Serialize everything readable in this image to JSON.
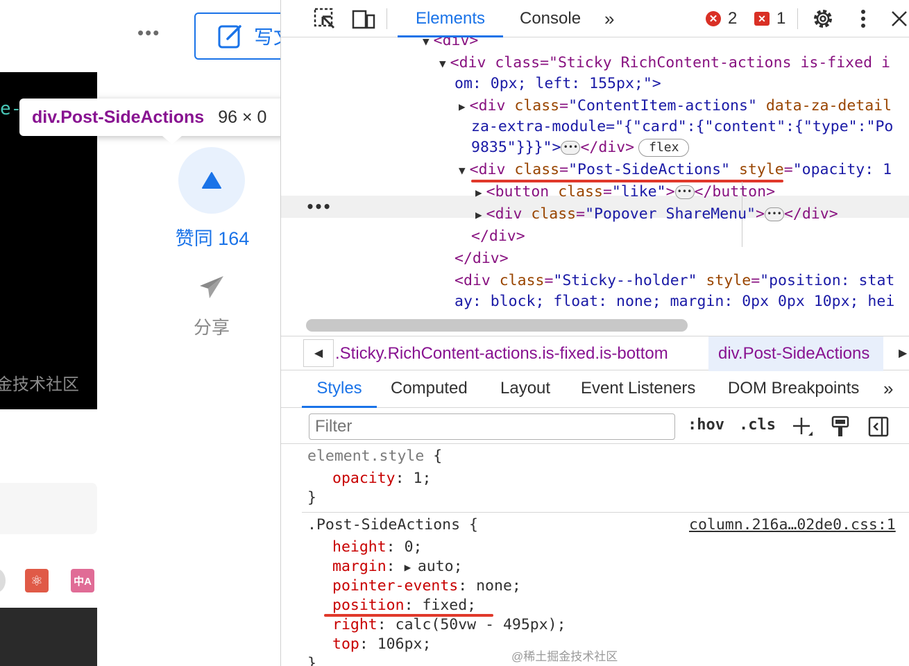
{
  "left": {
    "write_label": "写文",
    "edge_text": "e-",
    "tooltip": {
      "selector": "div.Post-SideActions",
      "dims": "96 × 0"
    },
    "like_label": "赞同 164",
    "share_label": "分享",
    "dark_watermark": "金技术社区",
    "ext_pink_label": "中A",
    "ext_red_label": "⚛"
  },
  "devtools": {
    "tabs": [
      "Elements",
      "Console"
    ],
    "errors_count": "2",
    "issues_count": "1",
    "dom_lines": {
      "l0": "<div>",
      "l1_open": "<div class=\"Sticky RichContent-actions is-fixed i",
      "l1_cont": "om: 0px; left: 155px;\">",
      "l2_a": "<div ",
      "l2_attr": "class",
      "l2_val": "\"ContentItem-actions\"",
      "l2_attr2": "data-za-detail",
      "l2_cont1": "za-extra-module=\"{\"card\":{\"content\":{\"type\":\"Po",
      "l2_cont2": "9835\"}}}\">",
      "l2_close": "</div>",
      "l2_pill": "flex",
      "sel_tag": "<div ",
      "sel_attr": "class",
      "sel_val": "\"Post-SideActions\"",
      "sel_attr2": "style",
      "sel_val2": "\"opacity: 1",
      "child1_open": "<button ",
      "child1_attr": "class",
      "child1_val": "\"like\"",
      "child1_close": "</button>",
      "child2_open": "<div ",
      "child2_attr": "class",
      "child2_val": "\"Popover ShareMenu\"",
      "child2_close": "</div>",
      "close1": "</div>",
      "close2": "</div>",
      "holder_open": "<div ",
      "holder_attr": "class",
      "holder_val": "\"Sticky--holder\"",
      "holder_attr2": "style",
      "holder_val2": "\"position: stat",
      "holder_cont": "ay: block; float: none; margin: 0px 0px 10px; hei"
    },
    "breadcrumb": {
      "item1": ".Sticky.RichContent-actions.is-fixed.is-bottom",
      "item2": "div.Post-SideActions"
    },
    "subtabs": [
      "Styles",
      "Computed",
      "Layout",
      "Event Listeners",
      "DOM Breakpoints"
    ],
    "filter_placeholder": "Filter",
    "hov": ":hov",
    "cls": ".cls",
    "styles": {
      "element_selector": "element.style",
      "element_prop": "opacity",
      "element_val": "1;",
      "rule_selector": ".Post-SideActions",
      "rule_source": "column.216a…02de0.css:1",
      "props": [
        {
          "name": "height",
          "value": "0;"
        },
        {
          "name": "margin",
          "value": "auto;"
        },
        {
          "name": "pointer-events",
          "value": "none;"
        },
        {
          "name": "position",
          "value": "fixed;"
        },
        {
          "name": "right",
          "value": "calc(50vw - 495px);"
        },
        {
          "name": "top",
          "value": "106px;"
        }
      ]
    },
    "watermark": "@稀土掘金技术社区"
  }
}
